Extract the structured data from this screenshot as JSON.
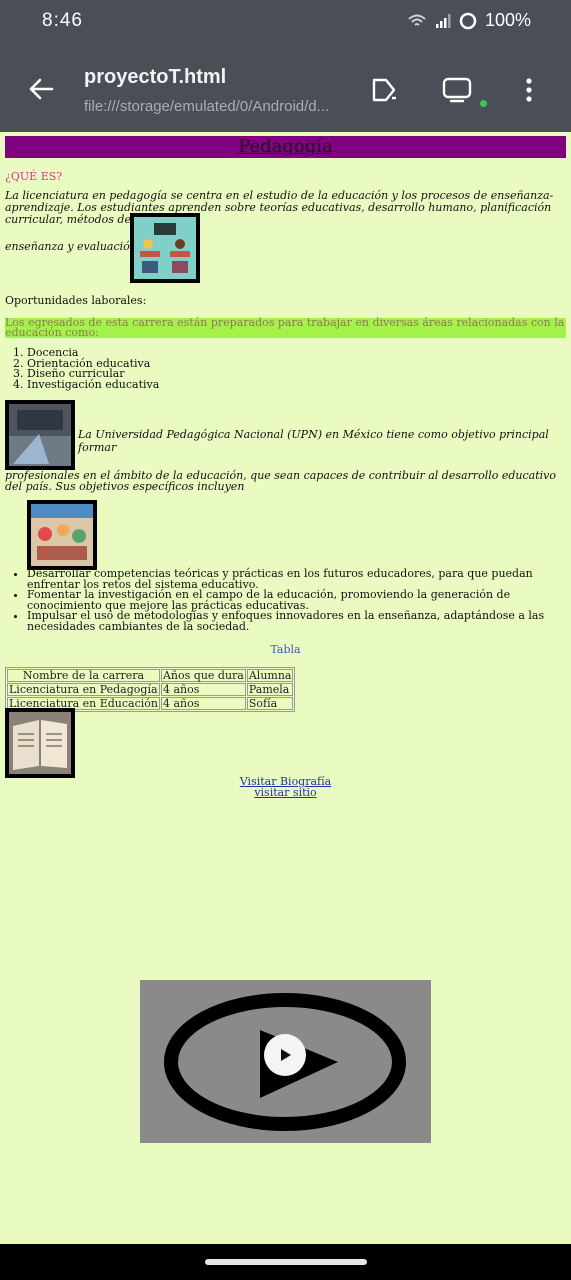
{
  "status": {
    "time": "8:46",
    "battery": "100%"
  },
  "browser": {
    "title": "proyectoT.html",
    "url": "file:///storage/emulated/0/Android/d..."
  },
  "content": {
    "heading": "Pedagogía",
    "question": "¿QUÉ ES?",
    "intro": "La licenciatura en pedagogía se centra en el estudio de la educación y los procesos de enseñanza-aprendizaje. Los estudiantes aprenden sobre teorías educativas, desarrollo humano, planificación curricular, métodos de",
    "intro_end": "enseñanza y evaluación.",
    "jobs_heading": "Oportunidades laborales:",
    "highlight": "Los egresados de esta carrera están preparados para trabajar en diversas áreas relacionadas con la educación como:",
    "jobs": [
      "Docencia",
      "Orientación educativa",
      "Diseño curricular",
      "Investigación educativa"
    ],
    "upn_a": "La Universidad Pedagógica Nacional (UPN) en México tiene como objetivo principal formar",
    "upn_b": "profesionales en el ámbito de la educación, que sean capaces de contribuir al desarrollo educativo del país. Sus objetivos específicos incluyen",
    "goals": [
      "Desarrollar competencias teóricas y prácticas en los futuros educadores, para que puedan enfrentar los retos del sistema educativo.",
      "Fomentar la investigación en el campo de la educación, promoviendo la generación de conocimiento que mejore las prácticas educativas.",
      "Impulsar el uso de metodologías y enfoques innovadores en la enseñanza, adaptándose a las necesidades cambiantes de la sociedad."
    ],
    "table_caption": "Tabla",
    "table": {
      "headers": [
        "Nombre de la carrera",
        "Años que dura",
        "Alumna"
      ],
      "rows": [
        [
          "Licenciatura en Pedagogía",
          "4 años",
          "Pamela"
        ],
        [
          "Licenciatura en Educación",
          "4 años",
          "Sofía"
        ]
      ]
    },
    "link1": "Visitar Biografía",
    "link2": "visitar sitio"
  },
  "colors": {
    "page_bg": "#e9fbc0",
    "banner": "#800080",
    "highlight": "#a4f14a",
    "toolbar": "#4a4e56"
  }
}
